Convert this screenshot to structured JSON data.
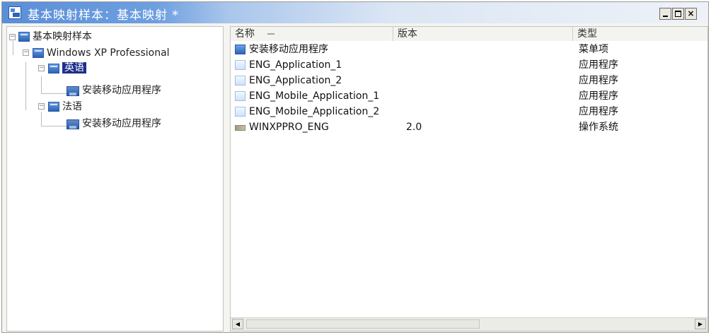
{
  "window": {
    "title": "基本映射样本：基本映射 *"
  },
  "tree": {
    "root": "基本映射样本",
    "os": "Windows XP Professional",
    "lang1": "英语",
    "lang1_child": "安装移动应用程序",
    "lang2": "法语",
    "lang2_child": "安装移动应用程序"
  },
  "list": {
    "columns": [
      "名称",
      "版本",
      "类型"
    ],
    "rows": [
      {
        "name": "安装移动应用程序",
        "version": "",
        "type": "菜单项",
        "icon": "menu-item-icon"
      },
      {
        "name": "ENG_Application_1",
        "version": "",
        "type": "应用程序",
        "icon": "application-icon"
      },
      {
        "name": "ENG_Application_2",
        "version": "",
        "type": "应用程序",
        "icon": "application-icon"
      },
      {
        "name": "ENG_Mobile_Application_1",
        "version": "",
        "type": "应用程序",
        "icon": "application-icon"
      },
      {
        "name": "ENG_Mobile_Application_2",
        "version": "",
        "type": "应用程序",
        "icon": "application-icon"
      },
      {
        "name": "WINXPPRO_ENG",
        "version": "2.0",
        "type": "操作系统",
        "icon": "operating-system-icon"
      }
    ]
  },
  "colors": {
    "title_gradient_start": "#5a8ed8",
    "selection": "#1e2e8a"
  }
}
